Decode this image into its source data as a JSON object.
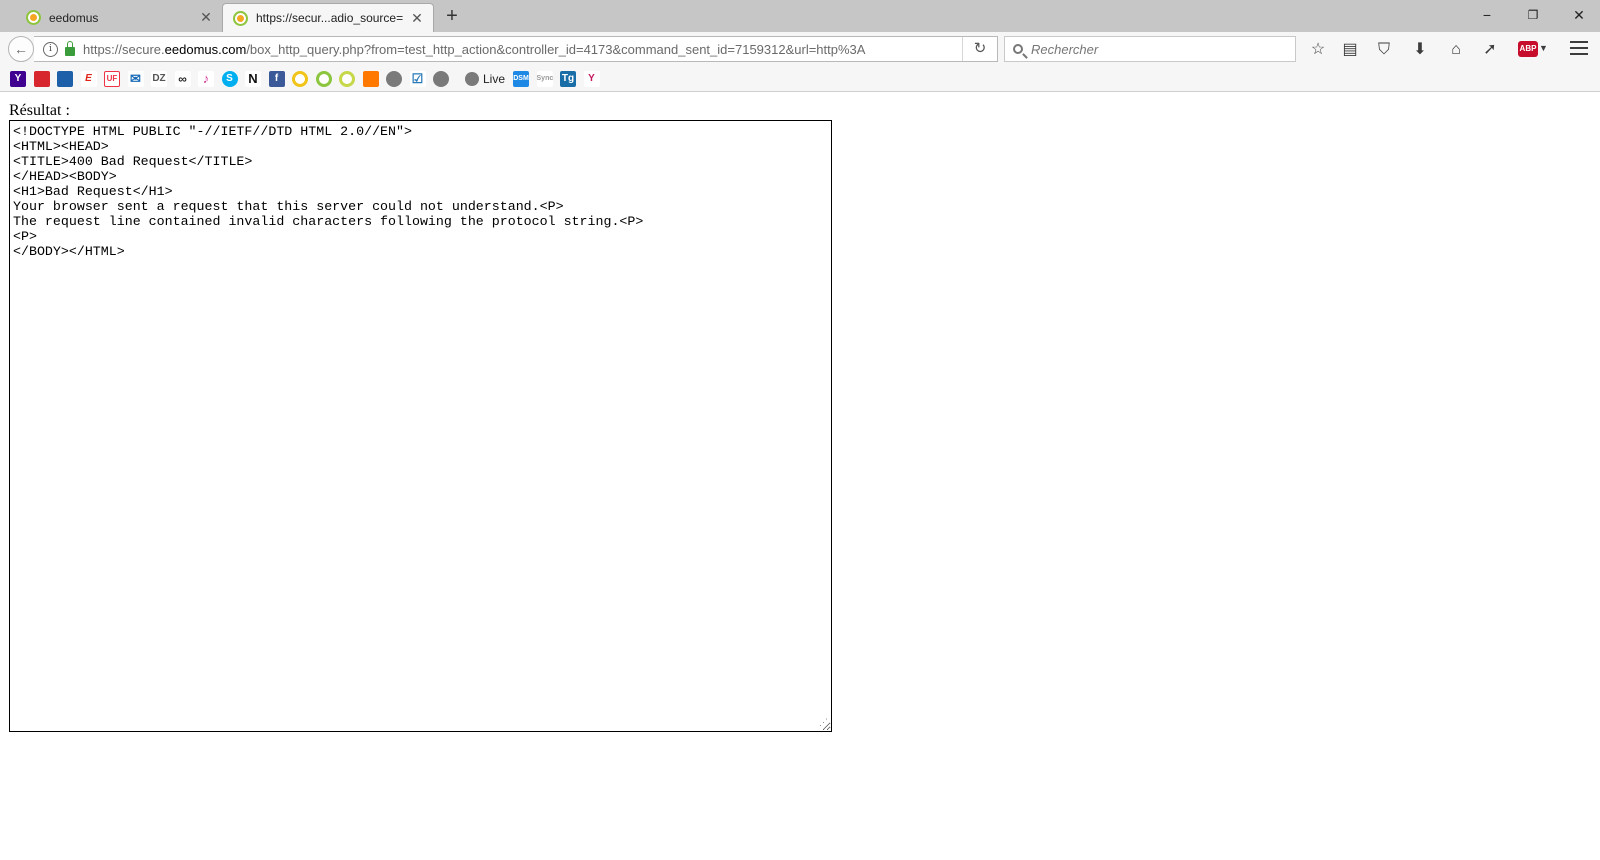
{
  "tabs": [
    {
      "label": "eedomus",
      "active": false
    },
    {
      "label": "https://secur...adio_source=",
      "active": true
    }
  ],
  "window_controls": {
    "minimize": "−",
    "restore": "❐",
    "close": "✕"
  },
  "navbar": {
    "url_domain_prefix": "https://secure.",
    "url_domain": "eedomus.com",
    "url_path": "/box_http_query.php?from=test_http_action&controller_id=4173&command_sent_id=7159312&url=http%3A",
    "search_placeholder": "Rechercher"
  },
  "bookmarks": {
    "icons": [
      "yahoo-icon",
      "marque-icon",
      "sticker-icon",
      "e-icon",
      "uf-icon",
      "mail-icon",
      "dz-icon",
      "tripadvisor-icon",
      "music-icon",
      "skype-icon",
      "n-icon",
      "facebook-icon",
      "eedomus-icon",
      "eedomus-icon-2",
      "eedomus-icon-3",
      "orange-icon",
      "globe-icon",
      "checkbox-icon",
      "globe-icon-2"
    ],
    "live_label": "Live",
    "trailing_icons": [
      "dsm-icon",
      "sync-icon",
      "tg-icon",
      "yp-icon"
    ]
  },
  "page": {
    "label": "Résultat :",
    "result_text": "<!DOCTYPE HTML PUBLIC \"-//IETF//DTD HTML 2.0//EN\">\n<HTML><HEAD>\n<TITLE>400 Bad Request</TITLE>\n</HEAD><BODY>\n<H1>Bad Request</H1>\nYour browser sent a request that this server could not understand.<P>\nThe request line contained invalid characters following the protocol string.<P>\n<P>\n</BODY></HTML>"
  }
}
